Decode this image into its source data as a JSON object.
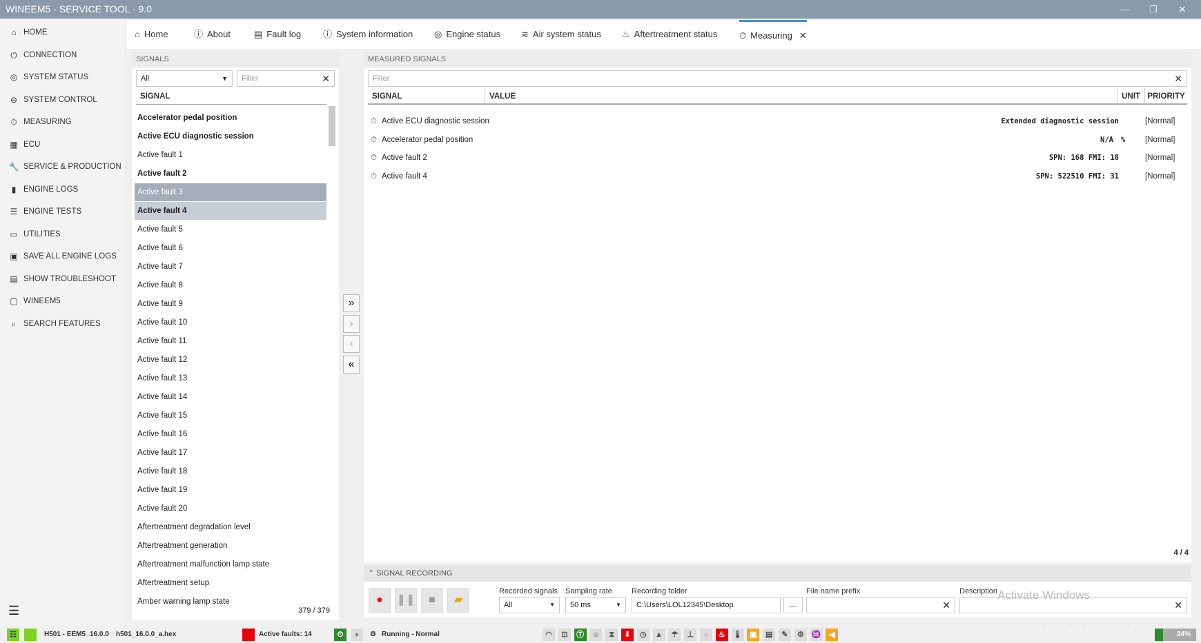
{
  "window": {
    "title": "WINEEM5 - SERVICE TOOL - 9.0"
  },
  "sidebar": {
    "items": [
      {
        "label": "HOME",
        "icon": "⌂"
      },
      {
        "label": "CONNECTION",
        "icon": "⏻"
      },
      {
        "label": "SYSTEM STATUS",
        "icon": "◎"
      },
      {
        "label": "SYSTEM CONTROL",
        "icon": "⊖"
      },
      {
        "label": "MEASURING",
        "icon": "⏱"
      },
      {
        "label": "ECU",
        "icon": "▦"
      },
      {
        "label": "SERVICE & PRODUCTION",
        "icon": "🔧"
      },
      {
        "label": "ENGINE LOGS",
        "icon": "▮"
      },
      {
        "label": "ENGINE TESTS",
        "icon": "☰"
      },
      {
        "label": "UTILITIES",
        "icon": "▭"
      },
      {
        "label": "SAVE ALL ENGINE LOGS",
        "icon": "▣"
      },
      {
        "label": "SHOW TROUBLESHOOT",
        "icon": "▤"
      },
      {
        "label": "WINEEM5",
        "icon": "▢"
      },
      {
        "label": "SEARCH FEATURES",
        "icon": "⌕"
      }
    ]
  },
  "tabs": [
    {
      "label": "Home",
      "icon": "⌂"
    },
    {
      "label": "About",
      "icon": "ⓘ"
    },
    {
      "label": "Fault log",
      "icon": "▤"
    },
    {
      "label": "System information",
      "icon": "ⓘ"
    },
    {
      "label": "Engine status",
      "icon": "◎"
    },
    {
      "label": "Air system status",
      "icon": "≋"
    },
    {
      "label": "Aftertreatment status",
      "icon": "♨"
    },
    {
      "label": "Measuring",
      "icon": "⏱",
      "active": true
    }
  ],
  "signals": {
    "header": "SIGNALS",
    "group": "All",
    "filter_placeholder": "Filter",
    "column": "SIGNAL",
    "count": "379 / 379",
    "items": [
      "Accelerator pedal position",
      "Active ECU diagnostic session",
      "Active fault 1",
      "Active fault 2",
      "Active fault 3",
      "Active fault 4",
      "Active fault 5",
      "Active fault 6",
      "Active fault 7",
      "Active fault 8",
      "Active fault 9",
      "Active fault 10",
      "Active fault 11",
      "Active fault 12",
      "Active fault 13",
      "Active fault 14",
      "Active fault 15",
      "Active fault 16",
      "Active fault 17",
      "Active fault 18",
      "Active fault 19",
      "Active fault 20",
      "Aftertreatment degradation level",
      "Aftertreatment generation",
      "Aftertreatment malfunction lamp state",
      "Aftertreatment setup",
      "Amber warning lamp state"
    ]
  },
  "measured": {
    "header": "MEASURED SIGNALS",
    "filter_placeholder": "Filter",
    "columns": {
      "signal": "SIGNAL",
      "value": "VALUE",
      "unit": "UNIT",
      "priority": "PRIORITY"
    },
    "count": "4 / 4",
    "rows": [
      {
        "signal": "Active ECU diagnostic session",
        "value": "Extended diagnostic session",
        "unit": "",
        "priority": "[Normal]"
      },
      {
        "signal": "Accelerator pedal position",
        "value": "N/A",
        "unit": "%",
        "priority": "[Normal]"
      },
      {
        "signal": "Active fault 2",
        "value": "SPN: 168 FMI: 18",
        "unit": "",
        "priority": "[Normal]"
      },
      {
        "signal": "Active fault 4",
        "value": "SPN: 522510 FMI: 31",
        "unit": "",
        "priority": "[Normal]"
      }
    ]
  },
  "recording": {
    "header": "SIGNAL RECORDING",
    "recorded_label": "Recorded signals",
    "recorded_value": "All",
    "rate_label": "Sampling rate",
    "rate_value": "50 ms",
    "folder_label": "Recording folder",
    "folder_value": "C:\\Users\\LOL12345\\Desktop",
    "browse": "...",
    "prefix_label": "File name prefix",
    "desc_label": "Description"
  },
  "status": {
    "device": "H501 - EEM5",
    "version": "16.0.0",
    "file": "h501_16.0.0_a.hex",
    "faults": "Active faults: 14",
    "engine": "Running - Normal",
    "battery": "24%"
  },
  "watermark": {
    "line1": "Activate Windows",
    "line2": "Go to Settings to activate Windows."
  },
  "colors": {
    "accent": "#4a90c8",
    "fault": "#e8000b",
    "ok": "#2e8b2e",
    "warn": "#f5a623"
  }
}
